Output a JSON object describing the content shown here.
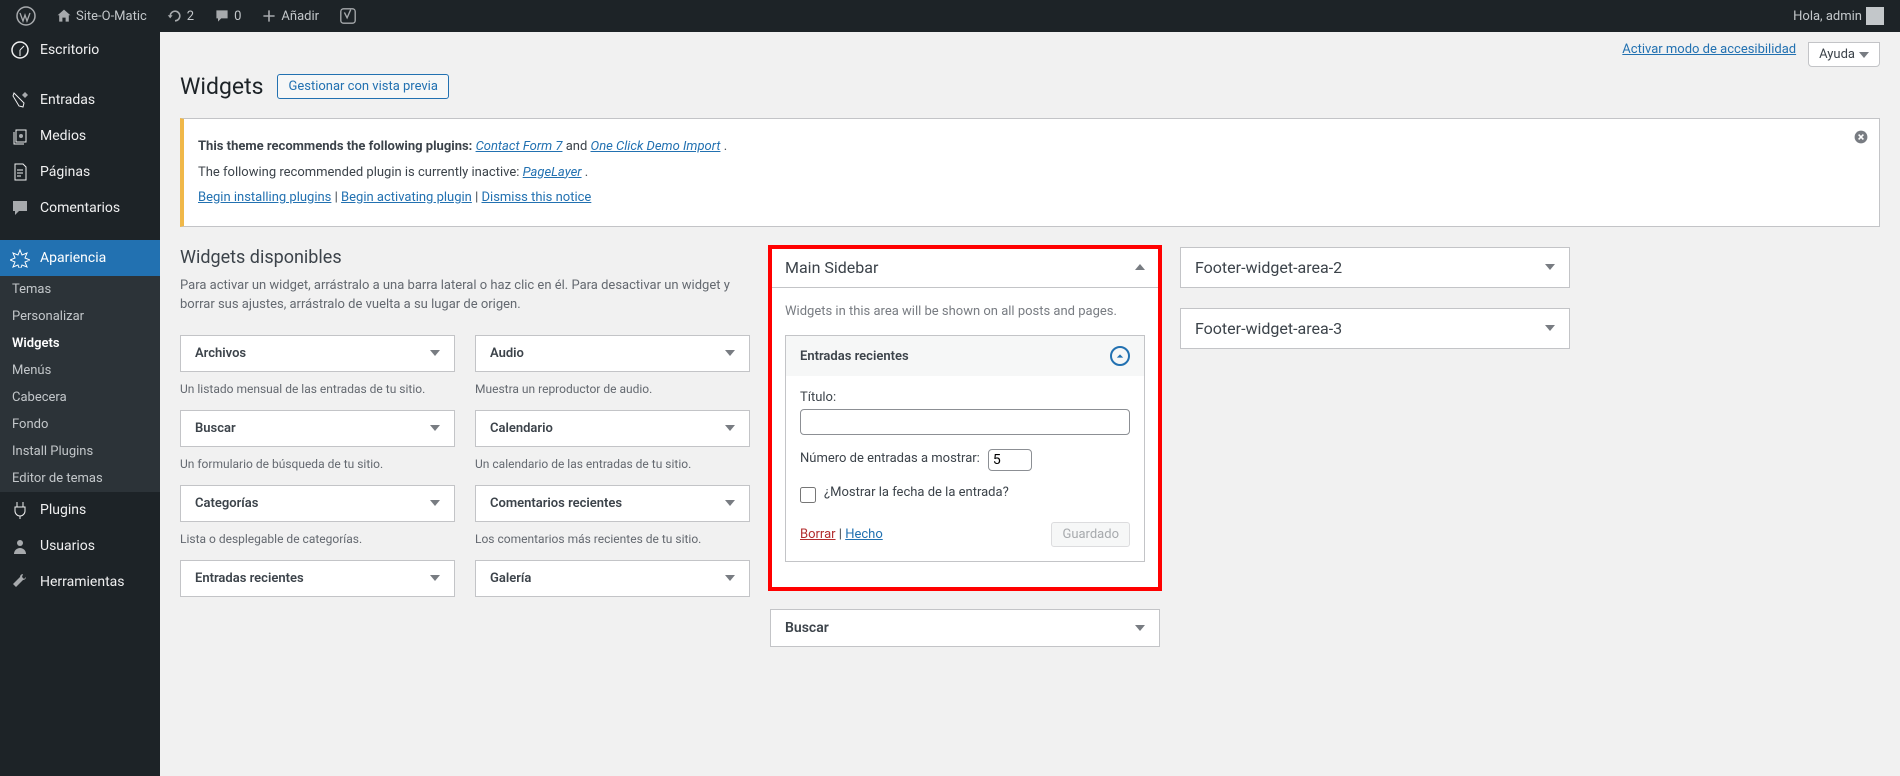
{
  "adminbar": {
    "site_name": "Site-O-Matic",
    "updates": "2",
    "comments": "0",
    "add_new": "Añadir",
    "greeting": "Hola, admin"
  },
  "menu": {
    "dashboard": "Escritorio",
    "posts": "Entradas",
    "media": "Medios",
    "pages": "Páginas",
    "comments": "Comentarios",
    "appearance": "Apariencia",
    "plugins": "Plugins",
    "users": "Usuarios",
    "tools": "Herramientas",
    "sub": {
      "themes": "Temas",
      "customize": "Personalizar",
      "widgets": "Widgets",
      "menus": "Menús",
      "header": "Cabecera",
      "background": "Fondo",
      "install_plugins": "Install Plugins",
      "theme_editor": "Editor de temas"
    }
  },
  "top_actions": {
    "accessibility": "Activar modo de accesibilidad",
    "help": "Ayuda"
  },
  "page": {
    "title": "Widgets",
    "manage_preview": "Gestionar con vista previa"
  },
  "notice": {
    "line1a": "This theme recommends the following plugins: ",
    "link1": "Contact Form 7",
    "line1b": " and ",
    "link2": "One Click Demo Import",
    "line1c": ".",
    "line2a": "The following recommended plugin is currently inactive: ",
    "link3": "PageLayer",
    "line2b": ".",
    "action1": "Begin installing plugins",
    "sep1": " | ",
    "action2": "Begin activating plugin",
    "sep2": " | ",
    "action3": "Dismiss this notice"
  },
  "available": {
    "heading": "Widgets disponibles",
    "desc": "Para activar un widget, arrástralo a una barra lateral o haz clic en él. Para desactivar un widget y borrar sus ajustes, arrástralo de vuelta a su lugar de origen.",
    "widgets": [
      {
        "name": "Archivos",
        "desc": "Un listado mensual de las entradas de tu sitio."
      },
      {
        "name": "Audio",
        "desc": "Muestra un reproductor de audio."
      },
      {
        "name": "Buscar",
        "desc": "Un formulario de búsqueda de tu sitio."
      },
      {
        "name": "Calendario",
        "desc": "Un calendario de las entradas de tu sitio."
      },
      {
        "name": "Categorías",
        "desc": "Lista o desplegable de categorías."
      },
      {
        "name": "Comentarios recientes",
        "desc": "Los comentarios más recientes de tu sitio."
      },
      {
        "name": "Entradas recientes",
        "desc": ""
      },
      {
        "name": "Galería",
        "desc": ""
      }
    ]
  },
  "sidebars": {
    "main": {
      "title": "Main Sidebar",
      "desc": "Widgets in this area will be shown on all posts and pages.",
      "widget_open": {
        "name": "Entradas recientes",
        "title_label": "Título:",
        "title_value": "",
        "count_label": "Número de entradas a mostrar:",
        "count_value": "5",
        "show_date_label": "¿Mostrar la fecha de la entrada?",
        "delete": "Borrar",
        "sep": " | ",
        "done": "Hecho",
        "saved": "Guardado"
      },
      "widget_collapsed": {
        "name": "Buscar"
      }
    },
    "footer2": {
      "title": "Footer-widget-area-2"
    },
    "footer3": {
      "title": "Footer-widget-area-3"
    }
  }
}
